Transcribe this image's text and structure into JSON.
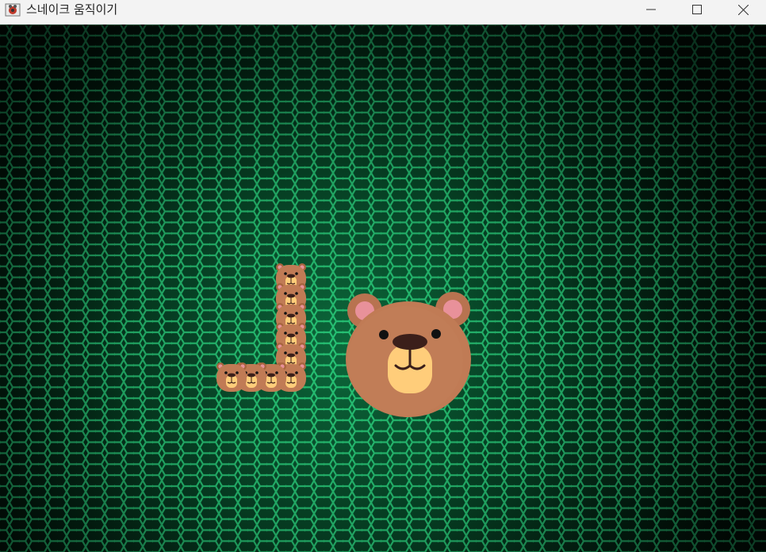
{
  "window": {
    "title": "스네이크 움직이기",
    "controls": [
      "minimize",
      "maximize",
      "close"
    ]
  },
  "icons": {
    "app": "bear-app-icon",
    "minimize": "minimize-icon",
    "maximize": "maximize-icon",
    "close": "close-icon"
  },
  "game": {
    "background": "green-hexagon-grid",
    "snake_segment_count": 10,
    "snake_shape": "L",
    "food": "bear-face",
    "colors": {
      "hex_glow": "#2bd47f",
      "hex_dark": "#041a0f",
      "bear_fur": "#c07b55",
      "bear_muzzle": "#ffcd7a",
      "bear_inner_ear": "#e8919a",
      "bear_nose": "#3b1f1a"
    }
  }
}
